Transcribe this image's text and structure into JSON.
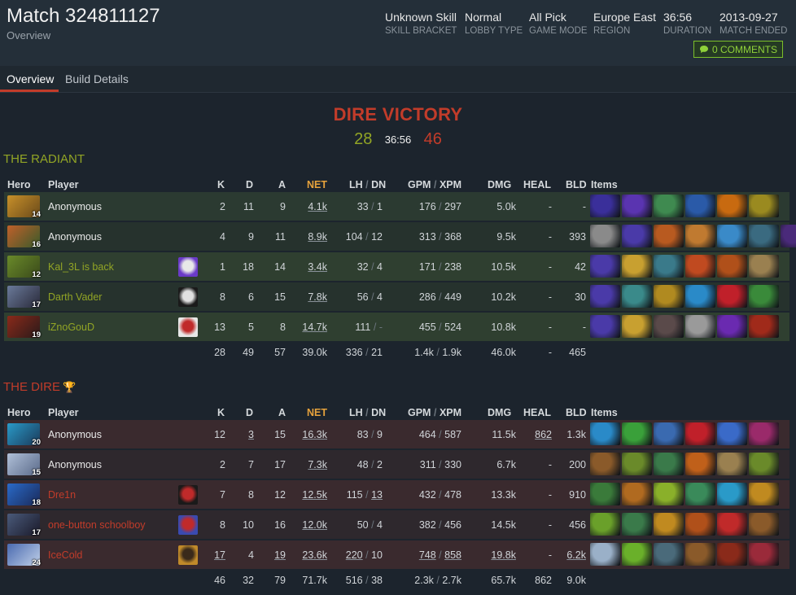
{
  "match": {
    "title": "Match 324811127",
    "subtitle": "Overview",
    "meta": [
      {
        "value": "Unknown Skill",
        "label": "SKILL BRACKET"
      },
      {
        "value": "Normal",
        "label": "LOBBY TYPE"
      },
      {
        "value": "All Pick",
        "label": "GAME MODE"
      },
      {
        "value": "Europe East",
        "label": "REGION"
      },
      {
        "value": "36:56",
        "label": "DURATION"
      },
      {
        "value": "2013-09-27",
        "label": "MATCH ENDED"
      }
    ],
    "comments_label": "0 COMMENTS"
  },
  "tabs": [
    {
      "label": "Overview"
    },
    {
      "label": "Build Details"
    }
  ],
  "result": {
    "victory_text": "DIRE VICTORY",
    "radiant_score": "28",
    "time": "36:56",
    "dire_score": "46"
  },
  "columns": {
    "hero": "Hero",
    "player": "Player",
    "k": "K",
    "d": "D",
    "a": "A",
    "net": "NET",
    "lh": "LH",
    "dn": "DN",
    "gpm": "GPM",
    "xpm": "XPM",
    "dmg": "DMG",
    "heal": "HEAL",
    "bld": "BLD",
    "items": "Items",
    "sep": "/"
  },
  "radiant": {
    "title": "THE RADIANT",
    "players": [
      {
        "level": "14",
        "name": "Anonymous",
        "k": "2",
        "d": "11",
        "a": "9",
        "net": "4.1k",
        "lh": "33",
        "dn": "1",
        "gpm": "176",
        "xpm": "297",
        "dmg": "5.0k",
        "heal": "-",
        "bld": "-",
        "hero_colors": [
          "#c8902a",
          "#6a4a1a"
        ],
        "avatar": null,
        "items": [
          "#3a2f9a",
          "#5a34b0",
          "#3f8a50",
          "#2a5aa8",
          "#c86a10",
          "#9a8a20"
        ]
      },
      {
        "level": "16",
        "name": "Anonymous",
        "k": "4",
        "d": "9",
        "a": "11",
        "net": "8.9k",
        "lh": "104",
        "dn": "12",
        "gpm": "313",
        "xpm": "368",
        "dmg": "9.5k",
        "heal": "-",
        "bld": "393",
        "hero_colors": [
          "#c0602a",
          "#3a5a2a"
        ],
        "avatar": null,
        "items": [
          "#8a8a8a",
          "#4a3aa8",
          "#b85a20",
          "#c07a30",
          "#3a8ac8",
          "#3a6a80",
          "#4a2a7a"
        ]
      },
      {
        "level": "12",
        "name": "Kal_3L is back",
        "k": "1",
        "d": "18",
        "a": "14",
        "net": "3.4k",
        "lh": "32",
        "dn": "4",
        "gpm": "171",
        "xpm": "238",
        "dmg": "10.5k",
        "heal": "-",
        "bld": "42",
        "hero_colors": [
          "#6a8a2a",
          "#3a4a1a"
        ],
        "avatar": [
          "#6a3ac8",
          "#e8e8e8"
        ],
        "items": [
          "#4a3aa8",
          "#c8a030",
          "#3a7a8a",
          "#c04a20",
          "#b0501a",
          "#9a8050"
        ]
      },
      {
        "level": "17",
        "name": "Darth Vader",
        "k": "8",
        "d": "6",
        "a": "15",
        "net": "7.8k",
        "lh": "56",
        "dn": "4",
        "gpm": "286",
        "xpm": "449",
        "dmg": "10.2k",
        "heal": "-",
        "bld": "30",
        "hero_colors": [
          "#6a7a9a",
          "#2a2a3a"
        ],
        "avatar": [
          "#1a1a1a",
          "#e0e0e0"
        ],
        "items": [
          "#4a3aa8",
          "#3a8a8a",
          "#b08a20",
          "#2a8ac8",
          "#c0202a",
          "#3a8a3a"
        ]
      },
      {
        "level": "19",
        "name": "iZnoGouD",
        "k": "13",
        "d": "5",
        "a": "8",
        "net": "14.7k",
        "lh": "111",
        "dn": "-",
        "gpm": "455",
        "xpm": "524",
        "dmg": "10.8k",
        "heal": "-",
        "bld": "-",
        "hero_colors": [
          "#8a2a1a",
          "#2a1a1a"
        ],
        "avatar": [
          "#e8e8e8",
          "#c02a2a"
        ],
        "items": [
          "#4a3aa8",
          "#c8a030",
          "#5a4a4a",
          "#9a9a9a",
          "#6a2ab0",
          "#a02a1a"
        ]
      }
    ],
    "totals": {
      "k": "28",
      "d": "49",
      "a": "57",
      "net": "39.0k",
      "lh": "336",
      "dn": "21",
      "gpm": "1.4k",
      "xpm": "1.9k",
      "dmg": "46.0k",
      "heal": "-",
      "bld": "465"
    }
  },
  "dire": {
    "title": "THE DIRE",
    "players": [
      {
        "level": "20",
        "name": "Anonymous",
        "k": "12",
        "d": "3",
        "a": "15",
        "net": "16.3k",
        "lh": "83",
        "dn": "9",
        "gpm": "464",
        "xpm": "587",
        "dmg": "11.5k",
        "heal": "862",
        "bld": "1.3k",
        "hero_colors": [
          "#2a9ac8",
          "#1a3a5a"
        ],
        "avatar": null,
        "items": [
          "#2a8ac8",
          "#3aa03a",
          "#3a6ab0",
          "#c0202a",
          "#3a6ac8",
          "#9a2a6a"
        ]
      },
      {
        "level": "15",
        "name": "Anonymous",
        "k": "2",
        "d": "7",
        "a": "17",
        "net": "7.3k",
        "lh": "48",
        "dn": "2",
        "gpm": "311",
        "xpm": "330",
        "dmg": "6.7k",
        "heal": "-",
        "bld": "200",
        "hero_colors": [
          "#b0c0d8",
          "#5a6a8a"
        ],
        "avatar": null,
        "items": [
          "#8a5a2a",
          "#6a8a2a",
          "#3a7a4a",
          "#c0601a",
          "#9a8050",
          "#6a8a2a"
        ]
      },
      {
        "level": "18",
        "name": "Dre1n",
        "k": "7",
        "d": "8",
        "a": "12",
        "net": "12.5k",
        "lh": "115",
        "dn": "13",
        "gpm": "432",
        "xpm": "478",
        "dmg": "13.3k",
        "heal": "-",
        "bld": "910",
        "hero_colors": [
          "#2a6ac8",
          "#1a2a5a"
        ],
        "avatar": [
          "#1a1a1a",
          "#c02a2a"
        ],
        "items": [
          "#3a7a3a",
          "#b06a20",
          "#8ab02a",
          "#3a8a5a",
          "#2a9ac8",
          "#c08a20"
        ]
      },
      {
        "level": "17",
        "name": "one-button schoolboy",
        "k": "8",
        "d": "10",
        "a": "16",
        "net": "12.0k",
        "lh": "50",
        "dn": "4",
        "gpm": "382",
        "xpm": "456",
        "dmg": "14.5k",
        "heal": "-",
        "bld": "456",
        "hero_colors": [
          "#4a5a7a",
          "#1a1a2a"
        ],
        "avatar": [
          "#3a4ab0",
          "#c02a2a"
        ],
        "items": [
          "#6aa02a",
          "#3a7a4a",
          "#c08a20",
          "#b0501a",
          "#c02a2a",
          "#8a5a2a"
        ]
      },
      {
        "level": "24",
        "name": "IceCold",
        "k": "17",
        "d": "4",
        "a": "19",
        "net": "23.6k",
        "lh": "220",
        "dn": "10",
        "gpm": "748",
        "xpm": "858",
        "dmg": "19.8k",
        "heal": "-",
        "bld": "6.2k",
        "hero_colors": [
          "#4a6ab0",
          "#c0d0e8"
        ],
        "avatar": [
          "#c08a2a",
          "#3a2a1a"
        ],
        "items": [
          "#9ab0c8",
          "#6ab02a",
          "#4a6a7a",
          "#8a5a2a",
          "#8a2a1a",
          "#9a2a3a"
        ]
      }
    ],
    "totals": {
      "k": "46",
      "d": "32",
      "a": "79",
      "net": "71.7k",
      "lh": "516",
      "dn": "38",
      "gpm": "2.3k",
      "xpm": "2.7k",
      "dmg": "65.7k",
      "heal": "862",
      "bld": "9.0k"
    }
  },
  "icons": {
    "comments": "speech-bubble-icon",
    "trophy": "trophy-icon"
  }
}
